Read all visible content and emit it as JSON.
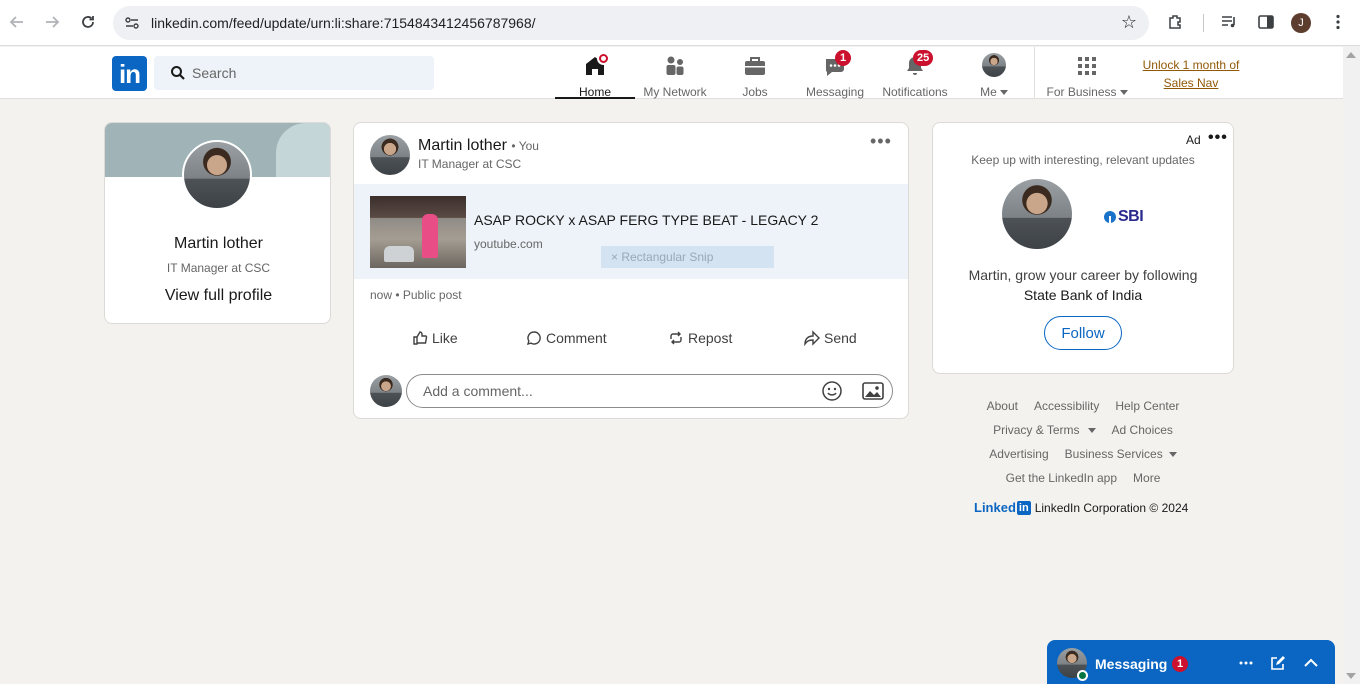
{
  "browser": {
    "url": "linkedin.com/feed/update/urn:li:share:7154843412456787968/",
    "profile_initial": "J"
  },
  "header": {
    "search_placeholder": "Search",
    "nav": [
      {
        "label": "Home",
        "icon": "home-icon"
      },
      {
        "label": "My Network",
        "icon": "network-icon"
      },
      {
        "label": "Jobs",
        "icon": "briefcase-icon"
      },
      {
        "label": "Messaging",
        "icon": "messaging-icon",
        "badge": "1"
      },
      {
        "label": "Notifications",
        "icon": "bell-icon",
        "badge": "25"
      },
      {
        "label": "Me",
        "icon": "avatar"
      }
    ],
    "for_business": "For Business",
    "promo_line1": "Unlock 1 month of",
    "promo_line2": "Sales Nav"
  },
  "profile": {
    "name": "Martin lother",
    "title": "IT Manager at CSC",
    "link": "View full profile"
  },
  "post": {
    "author": "Martin lother",
    "you": "• You",
    "subtitle": "IT Manager at CSC",
    "link_title": "ASAP ROCKY x ASAP FERG TYPE BEAT - LEGACY 2",
    "link_domain": "youtube.com",
    "snip_overlay": "Rectangular Snip",
    "meta": "now • Public post",
    "actions": {
      "like": "Like",
      "comment": "Comment",
      "repost": "Repost",
      "send": "Send"
    },
    "comment_placeholder": "Add a comment..."
  },
  "ad": {
    "label": "Ad",
    "tagline": "Keep up with interesting, relevant updates",
    "logo_text": "SBI",
    "pitch": "Martin, grow your career by following",
    "org": "State Bank of India",
    "follow": "Follow"
  },
  "footer": {
    "links": [
      "About",
      "Accessibility",
      "Help Center",
      "Privacy & Terms",
      "Ad Choices",
      "Advertising",
      "Business Services",
      "Get the LinkedIn app",
      "More"
    ],
    "brand_word": "Linked",
    "brand_in": "in",
    "copyright": "LinkedIn Corporation © 2024"
  },
  "messaging": {
    "label": "Messaging",
    "badge": "1"
  },
  "colors": {
    "brand": "#0a66c2",
    "badge": "#cb112d",
    "promo": "#915907",
    "background": "#f4f2ee"
  }
}
